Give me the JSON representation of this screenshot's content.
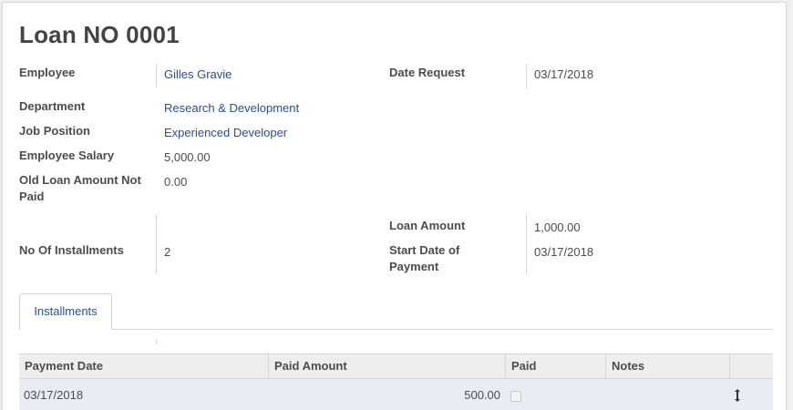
{
  "title": "Loan NO 0001",
  "fields": {
    "employee": {
      "label": "Employee",
      "value": "Gilles Gravie"
    },
    "date_request": {
      "label": "Date Request",
      "value": "03/17/2018"
    },
    "department": {
      "label": "Department",
      "value": "Research & Development"
    },
    "job_position": {
      "label": "Job Position",
      "value": "Experienced Developer"
    },
    "employee_salary": {
      "label": "Employee Salary",
      "value": "5,000.00"
    },
    "old_loan": {
      "label_line1": "Old Loan Amount Not",
      "label_line2": "Paid",
      "value": "0.00"
    },
    "loan_amount": {
      "label": "Loan Amount",
      "value": "1,000.00"
    },
    "installments": {
      "label": "No Of Installments",
      "value": "2"
    },
    "start_date": {
      "label_line1": "Start Date of",
      "label_line2": "Payment",
      "value": "03/17/2018"
    }
  },
  "tabs": [
    {
      "label": "Installments",
      "active": true
    }
  ],
  "table": {
    "columns": [
      "Payment Date",
      "Paid Amount",
      "Paid",
      "Notes"
    ],
    "rows": [
      {
        "payment_date": "03/17/2018",
        "paid_amount": "500.00",
        "paid": false,
        "notes": ""
      }
    ]
  },
  "colors": {
    "link": "#2b4f8a",
    "row_highlight": "#e9ecf3",
    "header_bg": "#eeeeee"
  },
  "icons": {
    "row_handle": "resize-vertical-icon"
  }
}
